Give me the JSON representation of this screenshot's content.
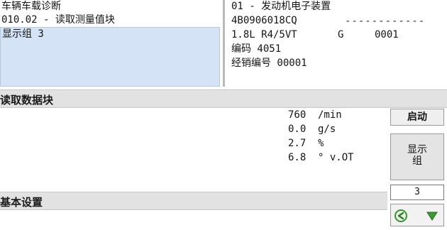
{
  "left_panel": {
    "title": "车辆车载诊断",
    "function": "010.02 - 读取测量值块",
    "selected_item": "显示组 3"
  },
  "right_panel": {
    "control_unit": "01 - 发动机电子装置",
    "part_number": "4B0906018CQ",
    "dashes": "------------",
    "engine": "1.8L R4/5VT",
    "letter": "G",
    "version": "0001",
    "coding": "编码 4051",
    "dealer": "经销编号 00001"
  },
  "sections": {
    "read_block": "读取数据块",
    "basic_settings": "基本设置"
  },
  "values": [
    {
      "value": "760",
      "unit": "/min"
    },
    {
      "value": "0.0",
      "unit": "g/s"
    },
    {
      "value": "2.7",
      "unit": "%"
    },
    {
      "value": "6.8",
      "unit": "° v.OT"
    }
  ],
  "controls": {
    "start_label": "启动",
    "group_label_1": "显示",
    "group_label_2": "组",
    "group_number": "3"
  },
  "icons": {
    "back": "back-arrow-icon",
    "forward": "forward-arrow-icon"
  }
}
